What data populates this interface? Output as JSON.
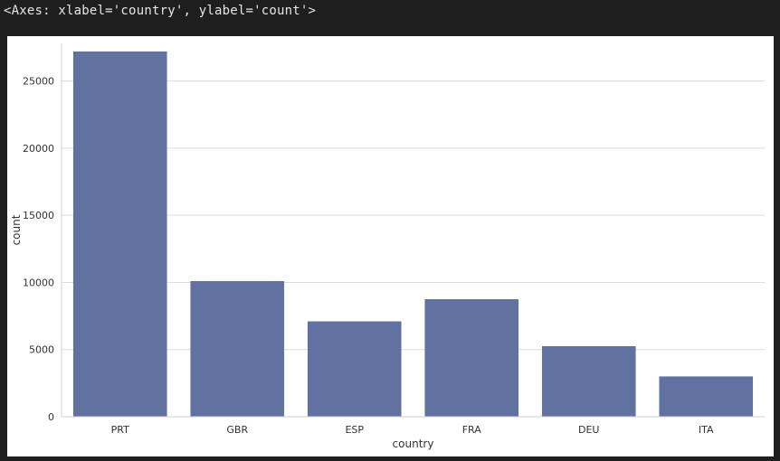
{
  "output_repr": "<Axes: xlabel='country', ylabel='count'>",
  "colors": {
    "bar": "#6172a0",
    "grid": "#dcdcdc",
    "axis": "#cfcfcf"
  },
  "chart_data": {
    "type": "bar",
    "categories": [
      "PRT",
      "GBR",
      "ESP",
      "FRA",
      "DEU",
      "ITA"
    ],
    "values": [
      27200,
      10100,
      7100,
      8750,
      5250,
      3000
    ],
    "xlabel": "country",
    "ylabel": "count",
    "ylim": [
      0,
      27800
    ],
    "yticks": [
      0,
      5000,
      10000,
      15000,
      20000,
      25000
    ],
    "grid": "y"
  }
}
